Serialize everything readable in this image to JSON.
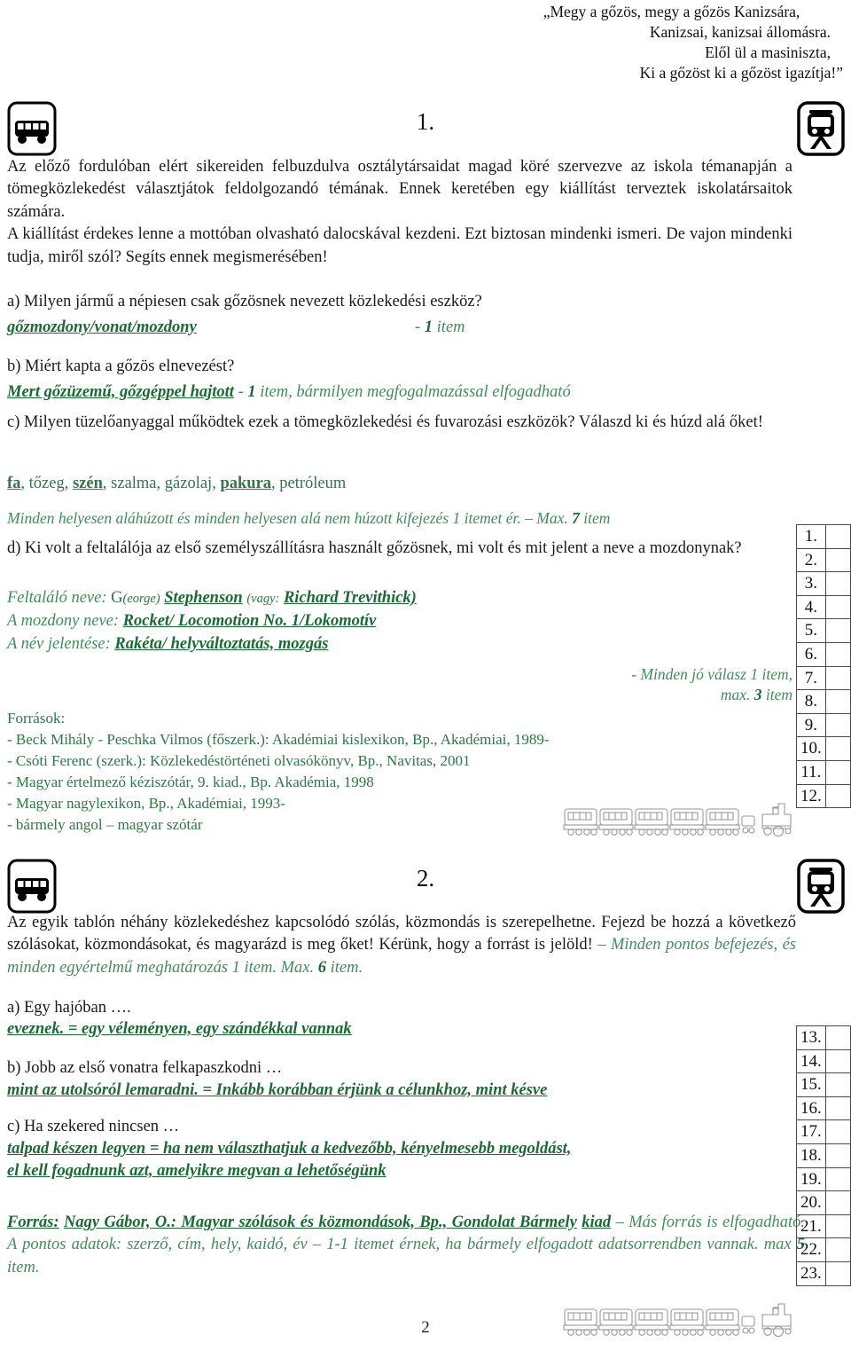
{
  "motto": {
    "line1": "„Megy a gőzös, megy a gőzös Kanizsára,",
    "line2": "Kanizsai, kanizsai állomásra.",
    "line3": "Elől ül a masiniszta,",
    "line4": "Ki a gőzöst ki a gőzöst igazítja!”"
  },
  "icons": {
    "bus": "bus-icon",
    "train": "train-front-icon",
    "steam_train": "steam-train-icon"
  },
  "section1": {
    "number": "1.",
    "intro": "Az előző fordulóban elért sikereiden felbuzdulva osztálytársaidat magad köré szervezve az iskola témanapján a tömegközlekedést választjátok feldolgozandó témának. Ennek keretében egy kiállítást terveztek iskolatársaitok számára.",
    "intro2": "A kiállítást érdekes lenne a mottóban olvasható dalocskával kezdeni. Ezt biztosan mindenki ismeri. De vajon mindenki tudja, miről szól? Segíts ennek megismerésében!",
    "qa": {
      "question": "a) Milyen jármű a népiesen csak gőzösnek nevezett közlekedési eszköz?",
      "answer": "gőzmozdony/vonat/mozdony",
      "score_dash": "-",
      "score_num": "1",
      "score_word": "item"
    },
    "qb": {
      "question": "b) Miért kapta a gőzös elnevezést?",
      "answer": "Mert gőzüzemű, gőzgéppel hajtott",
      "score_dash": "-",
      "score_num": "1",
      "score_rest": "item, bármilyen megfogalmazással elfogadható"
    },
    "qc": {
      "question": "c) Milyen tüzelőanyaggal működtek ezek a tömegközlekedési és fuvarozási eszközök? Válaszd ki és húzd alá őket!",
      "options": [
        {
          "text": "fa",
          "underlined": true
        },
        {
          "text": "tőzeg",
          "underlined": false
        },
        {
          "text": "szén",
          "underlined": true
        },
        {
          "text": "szalma",
          "underlined": false
        },
        {
          "text": "gázolaj",
          "underlined": false
        },
        {
          "text": "pakura",
          "underlined": true
        },
        {
          "text": "petróleum",
          "underlined": false
        }
      ],
      "note_a": "Minden helyesen aláhúzott és minden helyesen alá nem húzott kifejezés 1 itemet ér. – Max.",
      "note_num": "7",
      "note_b": "item"
    },
    "qd": {
      "question": "d) Ki volt a feltalálója az első személyszállításra használt gőzösnek, mi volt és mit jelent a neve a mozdonynak?",
      "label1": "Feltaláló neve:",
      "ans1_pre": "G",
      "ans1_paren": "(eorge)",
      "ans1_name": "Stephenson",
      "ans1_or": "(vagy:",
      "ans1_alt": "Richard Trevithick)",
      "label2": "A mozdony neve:",
      "ans2": "Rocket/ Locomotion No. 1/Lokomotív",
      "label3": "A név jelentése:",
      "ans3": "Rakéta/ helyváltoztatás, mozgás",
      "note_a": "- Minden jó válasz 1 item,",
      "note_b_pre": "max.",
      "note_b_num": "3",
      "note_b_post": "item"
    },
    "sources": {
      "title": "Források:",
      "items": [
        "- Beck Mihály - Peschka Vilmos (főszerk.): Akadémiai kislexikon, Bp., Akadémiai, 1989-",
        "- Csóti Ferenc (szerk.): Közlekedéstörténeti olvasókönyv, Bp., Navitas, 2001",
        "- Magyar értelmező kéziszótár, 9. kiad., Bp. Akadémia, 1998",
        "- Magyar nagylexikon, Bp., Akadémiai, 1993-",
        "- bármely angol – magyar szótár"
      ]
    }
  },
  "section2": {
    "number": "2.",
    "intro": "Az egyik tablón néhány közlekedéshez kapcsolódó szólás, közmondás is szerepelhetne. Fejezd be hozzá a következő szólásokat, közmondásokat, és magyarázd is meg őket! Kérünk, hogy a forrást is jelöld!",
    "intro_note_pre": "– Minden pontos befejezés, és minden egyértelmű meghatározás 1 item. Max.",
    "intro_note_num": "6",
    "intro_note_post": "item.",
    "qa": {
      "question": "a) Egy hajóban ….",
      "answer": "eveznek. = egy véleményen, egy szándékkal vannak"
    },
    "qb": {
      "question": "b) Jobb az első vonatra felkapaszkodni …",
      "answer": "mint az utolsóról lemaradni. = Inkább korábban érjünk a célunkhoz, mint késve"
    },
    "qc": {
      "question": "c) Ha szekered nincsen …",
      "answer_line1": "talpad készen legyen = ha nem választhatjuk a kedvezőbb, kényelmesebb megoldást,",
      "answer_line2": "el kell fogadnunk azt, amelyikre megvan a lehetőségünk"
    },
    "source": {
      "label": "Forrás:",
      "cite_line1": "Nagy Gábor, O.: Magyar szólások és közmondások, Bp., Gondolat Bármely",
      "cite_line2": "kiad",
      "note_line1": "– Más forrás is elfogadható. A pontos adatok: szerző, cím, hely, kaidó, év – 1-1 itemet érnek, ha",
      "note_line2_pre": "bármely elfogadott adatsorrendben vannak. max",
      "note_line2_num": "5",
      "note_line2_post": "item."
    }
  },
  "score_grid_1": {
    "rows": [
      "1.",
      "2.",
      "3.",
      "4.",
      "5.",
      "6.",
      "7.",
      "8.",
      "9.",
      "10.",
      "11.",
      "12."
    ]
  },
  "score_grid_2": {
    "rows": [
      "13.",
      "14.",
      "15.",
      "16.",
      "17.",
      "18.",
      "19.",
      "20.",
      "21.",
      "22.",
      "23."
    ]
  },
  "page_number": "2",
  "colors": {
    "answer_green": "#1a6b33",
    "note_green": "#3f8f58",
    "text_black": "#1a1a1a"
  }
}
